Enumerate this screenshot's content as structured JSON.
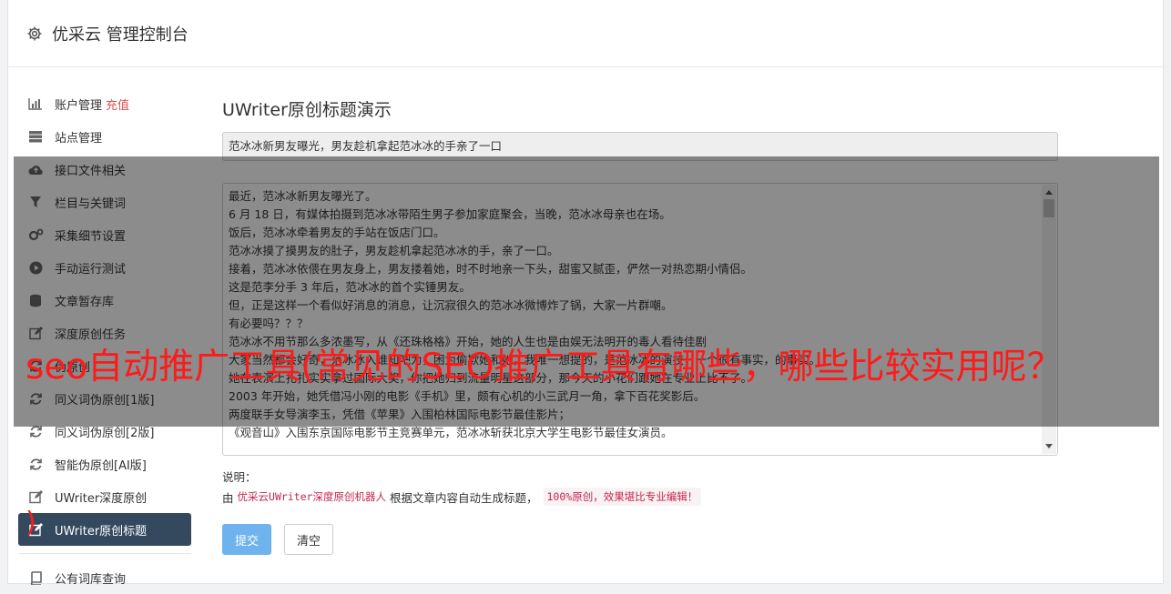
{
  "header": {
    "title": "优采云 管理控制台",
    "icon": "gear-icon"
  },
  "sidebar": {
    "items": [
      {
        "label": "账户管理",
        "extra": "充值",
        "icon": "bar-chart-icon"
      },
      {
        "label": "站点管理",
        "icon": "server-icon"
      },
      {
        "label": "接口文件相关",
        "icon": "cloud-upload-icon"
      },
      {
        "label": "栏目与关键词",
        "icon": "filter-icon"
      },
      {
        "label": "采集细节设置",
        "icon": "gears-icon"
      },
      {
        "label": "手动运行测试",
        "icon": "play-circle-icon"
      },
      {
        "label": "文章暂存库",
        "icon": "database-icon"
      },
      {
        "label": "深度原创任务",
        "icon": "edit-icon"
      },
      {
        "label": "伪原创",
        "icon": "refresh-icon"
      },
      {
        "label": "同义词伪原创[1版]",
        "icon": "refresh-icon"
      },
      {
        "label": "同义词伪原创[2版]",
        "icon": "refresh-icon"
      },
      {
        "label": "智能伪原创[AI版]",
        "icon": "refresh-icon"
      },
      {
        "label": "UWriter深度原创",
        "icon": "edit-icon"
      },
      {
        "label": "UWriter原创标题",
        "icon": "edit-icon",
        "active": true
      }
    ],
    "bottom_items": [
      {
        "label": "公有词库查询",
        "icon": "book-icon"
      }
    ]
  },
  "main": {
    "heading": "UWriter原创标题演示",
    "title_value": "范冰冰新男友曝光，男友趁机拿起范冰冰的手亲了一口",
    "article_lines": [
      "最近，范冰冰新男友曝光了。",
      "6 月 18 日，有媒体拍摄到范冰冰带陌生男子参加家庭聚会，当晚，范冰冰母亲也在场。",
      "饭后，范冰冰牵着男友的手站在饭店门口。",
      "范冰冰摸了摸男友的肚子，男友趁机拿起范冰冰的手，亲了一口。",
      "接着，范冰冰依偎在男友身上，男友搂着她，时不时地亲一下头，甜蜜又腻歪，俨然一对热恋期小情侣。",
      "这是范李分手 3 年后，范冰冰的首个实锤男友。",
      "但，正是这样一个看似好消息的消息，让沉寂很久的范冰冰微博炸了锅，大家一片群嘲。",
      "有必要吗？？？",
      "范冰冰不用节那么多浓墨写，从《还珠格格》开始，她的人生也是由娱无法明开的毒人看待佳剧",
      "大家当然都会好奇，范冰冰入谁知吧为，困为偷欺她和她，我唯一想提的，是范冰冰的演技，一个很有事实，的事实。",
      "她在表演上扎扎实实拿过国际大奖，你把她归到流量明星这部分，那今天的小花们跟她在专业上比不了。",
      "2003 年开始，她凭借冯小刚的电影《手机》里，颇有心机的小三武月一角，拿下百花奖影后。",
      "两度联手女导演李玉，凭借《苹果》入围柏林国际电影节最佳影片；",
      "《观音山》入围东京国际电影节主竞赛单元，范冰冰斩获北京大学生电影节最佳女演员。"
    ],
    "note_label": "说明：",
    "note_prefix": "由",
    "note_code": "优采云UWriter深度原创机器人",
    "note_middle": "根据文章内容自动生成标题，",
    "note_badge": "100%原创，效果堪比专业编辑！",
    "submit_label": "提交",
    "clear_label": "清空"
  },
  "overlay": {
    "headline": "seo自动推广工具(常见的SEO推广工具有哪些，哪些比较实用呢？",
    "closing": ")"
  },
  "colors": {
    "active_nav": "#35495e",
    "submit": "#6fb3ee",
    "accent_red": "#d9534f",
    "overlay_text": "#ff1a1a"
  }
}
